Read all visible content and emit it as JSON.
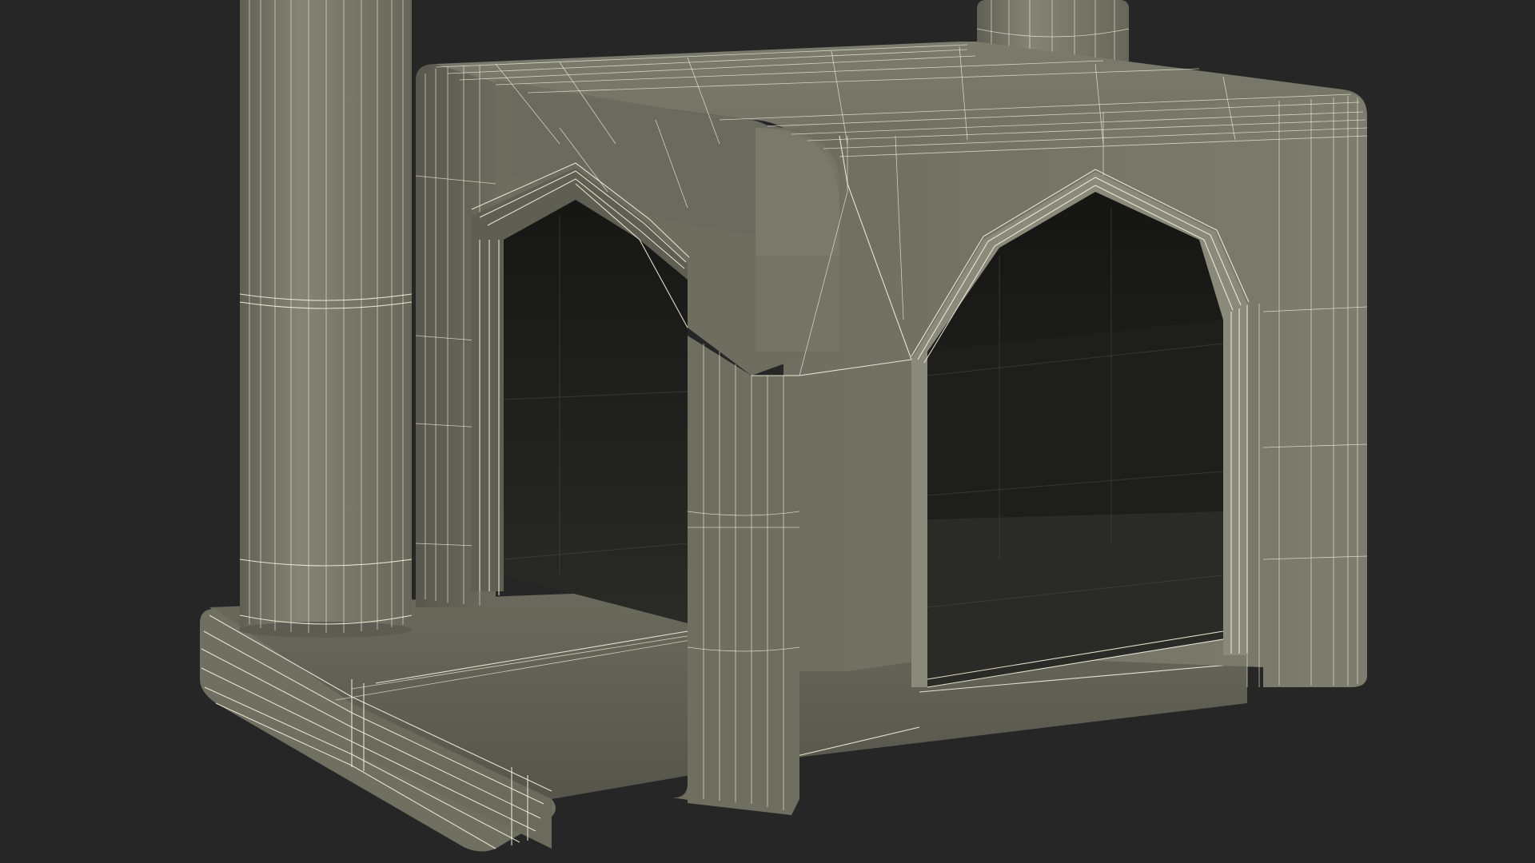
{
  "scene": {
    "background_color": "#262626",
    "surface_color": "#7a7a6c",
    "wireframe_color": "#f4f1dc",
    "interior_color": "#1c1c1a"
  },
  "objects": [
    {
      "name": "left-post"
    },
    {
      "name": "rear-post"
    },
    {
      "name": "house-box"
    },
    {
      "name": "front-arch-opening"
    },
    {
      "name": "side-arch-opening"
    },
    {
      "name": "base-platform"
    }
  ]
}
